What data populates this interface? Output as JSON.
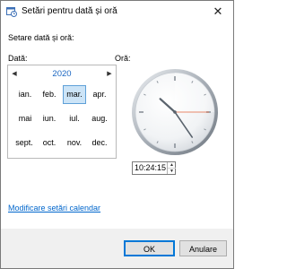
{
  "window": {
    "title": "Setări pentru dată și oră",
    "close_glyph": "✕"
  },
  "main": {
    "heading": "Setare dată și oră:",
    "date_label": "Dată:",
    "time_label": "Oră:"
  },
  "calendar": {
    "year": "2020",
    "prev_glyph": "◀",
    "next_glyph": "▶",
    "months": [
      "ian.",
      "feb.",
      "mar.",
      "apr.",
      "mai",
      "iun.",
      "iul.",
      "aug.",
      "sept.",
      "oct.",
      "nov.",
      "dec."
    ],
    "selected_month": "mar."
  },
  "clock": {
    "time_value": "10:24:15",
    "hour": 10,
    "minute": 24,
    "second": 15
  },
  "links": {
    "calendar_settings": "Modificare setări calendar"
  },
  "buttons": {
    "ok": "OK",
    "cancel": "Anulare"
  },
  "colors": {
    "link": "#0066cc",
    "year": "#1a66c2",
    "selected_month_bg": "#cce4f7",
    "selected_month_border": "#5fa0d8",
    "clock_second_hand": "#e3623a"
  },
  "icons": {
    "window_icon": "calendar-clock-icon",
    "spin_up": "arrow-up-icon",
    "spin_down": "arrow-down-icon"
  }
}
